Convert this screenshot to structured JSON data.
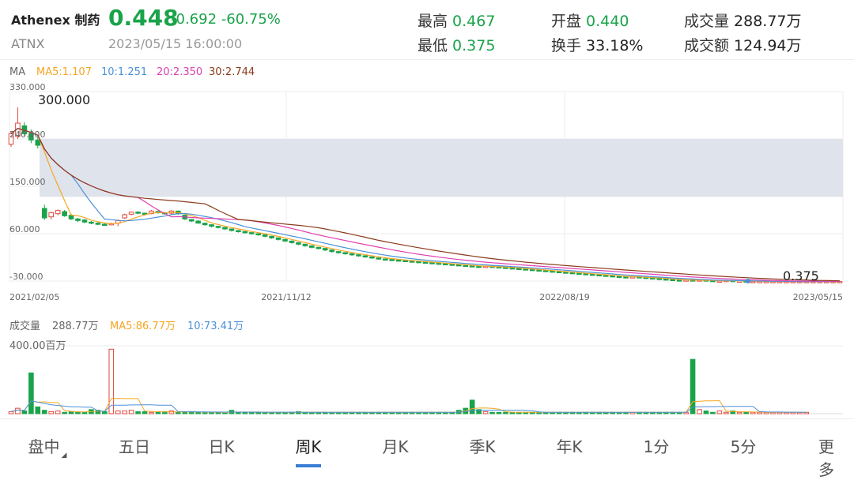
{
  "header": {
    "name": "Athenex 制药",
    "code": "ATNX",
    "price": "0.448",
    "change": "-0.692",
    "change_pct": "-60.75%",
    "datetime": "2023/05/15 16:00:00",
    "stats": [
      {
        "label": "最高",
        "value": "0.467",
        "tone": "green"
      },
      {
        "label": "开盘",
        "value": "0.440",
        "tone": "green"
      },
      {
        "label": "成交量",
        "value": "288.77万",
        "tone": "dark"
      },
      {
        "label": "最低",
        "value": "0.375",
        "tone": "green"
      },
      {
        "label": "换手",
        "value": "33.18%",
        "tone": "dark"
      },
      {
        "label": "成交额",
        "value": "124.94万",
        "tone": "dark"
      }
    ]
  },
  "ma_legend": {
    "title": "MA",
    "ma5": "MA5:1.107",
    "ma10": "10:1.251",
    "ma20": "20:2.350",
    "ma30": "30:2.744"
  },
  "vol_legend": {
    "title": "成交量",
    "value": "288.77万",
    "ma5": "MA5:86.77万",
    "ma10": "10:73.41万"
  },
  "colors": {
    "up": "#e2483d",
    "down": "#1aa34a",
    "ma5": "#f5a623",
    "ma10": "#4a90d9",
    "ma20": "#e040b0",
    "ma30": "#8b3a1a",
    "band": "#dfe4ec"
  },
  "chart_data": {
    "type": "candlestick",
    "y_ticks": [
      "330.000",
      "240.000",
      "150.000",
      "60.000",
      "-30.000"
    ],
    "y_range": [
      -30,
      330
    ],
    "x_labels": [
      "2021/02/05",
      "2021/11/12",
      "2022/08/19",
      "2023/05/15"
    ],
    "annotations": {
      "high_label": "300.000",
      "low_label": "0.375"
    },
    "band": [
      130,
      240
    ],
    "candles": [
      [
        230,
        250,
        225,
        255
      ],
      [
        245,
        270,
        240,
        300
      ],
      [
        265,
        250,
        245,
        272
      ],
      [
        250,
        238,
        232,
        258
      ],
      [
        238,
        228,
        222,
        245
      ],
      [
        108,
        90,
        86,
        115
      ],
      [
        92,
        100,
        87,
        102
      ],
      [
        98,
        104,
        95,
        106
      ],
      [
        102,
        94,
        92,
        105
      ],
      [
        95,
        88,
        86,
        98
      ],
      [
        88,
        85,
        82,
        90
      ],
      [
        86,
        82,
        80,
        88
      ],
      [
        82,
        80,
        78,
        84
      ],
      [
        80,
        78,
        76,
        82
      ],
      [
        78,
        77,
        75,
        80
      ],
      [
        77,
        79,
        76,
        81
      ],
      [
        80,
        85,
        74,
        87
      ],
      [
        90,
        96,
        88,
        98
      ],
      [
        97,
        101,
        95,
        102
      ],
      [
        101,
        99,
        97,
        103
      ],
      [
        99,
        97,
        96,
        100
      ],
      [
        98,
        103,
        97,
        105
      ],
      [
        102,
        100,
        98,
        104
      ],
      [
        100,
        98,
        96,
        101
      ],
      [
        99,
        103,
        97,
        105
      ],
      [
        103,
        98,
        96,
        104
      ],
      [
        95,
        88,
        86,
        96
      ],
      [
        87,
        84,
        82,
        88
      ],
      [
        84,
        80,
        79,
        86
      ],
      [
        80,
        77,
        75,
        81
      ],
      [
        77,
        74,
        72,
        78
      ],
      [
        74,
        72,
        70,
        75
      ],
      [
        72,
        69,
        67,
        73
      ],
      [
        69,
        66,
        64,
        70
      ],
      [
        66,
        64,
        62,
        67
      ],
      [
        64,
        62,
        60,
        65
      ],
      [
        62,
        60,
        58,
        63
      ],
      [
        60,
        58,
        56,
        61
      ],
      [
        58,
        55,
        53,
        59
      ],
      [
        55,
        52,
        50,
        56
      ],
      [
        52,
        49,
        47,
        53
      ],
      [
        49,
        46,
        44,
        50
      ],
      [
        46,
        43,
        41,
        47
      ],
      [
        43,
        40,
        38,
        44
      ],
      [
        40,
        37,
        35,
        41
      ],
      [
        37,
        34,
        32,
        38
      ],
      [
        34,
        32,
        30,
        35
      ],
      [
        32,
        29,
        27,
        33
      ],
      [
        29,
        26,
        24,
        30
      ],
      [
        26,
        24,
        22,
        27
      ],
      [
        24,
        22,
        20,
        25
      ],
      [
        22,
        20,
        18,
        23
      ],
      [
        20,
        18,
        16,
        21
      ],
      [
        18,
        16,
        14,
        19
      ],
      [
        16,
        14,
        12,
        17
      ],
      [
        14,
        12,
        10,
        15
      ],
      [
        12,
        11,
        9,
        13
      ],
      [
        11,
        10,
        8,
        12
      ],
      [
        10,
        9,
        7,
        11
      ],
      [
        9,
        8,
        6,
        10
      ],
      [
        8,
        7,
        5,
        9
      ],
      [
        7,
        6,
        4,
        8
      ],
      [
        6,
        5,
        3,
        7
      ],
      [
        5,
        4,
        2,
        6
      ],
      [
        4,
        3,
        1,
        5
      ],
      [
        3,
        2,
        0,
        4
      ],
      [
        2,
        1,
        -1,
        3
      ],
      [
        1,
        0,
        -1,
        2
      ],
      [
        0,
        -1,
        -2,
        1
      ],
      [
        -1,
        -2,
        -3,
        0
      ],
      [
        -2,
        -3,
        -4,
        -1
      ],
      [
        -3,
        -2,
        -4,
        -1
      ],
      [
        -2,
        -3,
        -4,
        -1
      ],
      [
        -3,
        -4,
        -5,
        -2
      ],
      [
        -4,
        -5,
        -6,
        -3
      ],
      [
        -5,
        -6,
        -7,
        -4
      ],
      [
        -6,
        -7,
        -8,
        -5
      ],
      [
        -7,
        -8,
        -9,
        -6
      ],
      [
        -8,
        -9,
        -10,
        -7
      ],
      [
        -9,
        -10,
        -11,
        -8
      ],
      [
        -10,
        -11,
        -12,
        -9
      ],
      [
        -11,
        -12,
        -13,
        -10
      ],
      [
        -12,
        -13,
        -14,
        -11
      ],
      [
        -13,
        -14,
        -15,
        -12
      ],
      [
        -14,
        -15,
        -16,
        -13
      ],
      [
        -15,
        -16,
        -17,
        -14
      ],
      [
        -16,
        -17,
        -18,
        -15
      ],
      [
        -17,
        -18,
        -19,
        -16
      ],
      [
        -18,
        -19,
        -20,
        -17
      ],
      [
        -19,
        -20,
        -21,
        -18
      ],
      [
        -20,
        -21,
        -22,
        -19
      ],
      [
        -21,
        -22,
        -23,
        -20
      ],
      [
        -22,
        -23,
        -24,
        -21
      ],
      [
        -23,
        -22,
        -24,
        -21
      ],
      [
        -22,
        -23,
        -24,
        -21
      ],
      [
        -23,
        -24,
        -25,
        -22
      ],
      [
        -24,
        -25,
        -26,
        -23
      ],
      [
        -25,
        -26,
        -27,
        -24
      ],
      [
        -26,
        -27,
        -28,
        -25
      ],
      [
        -27,
        -28,
        -29,
        -26
      ],
      [
        -28,
        -29,
        -30,
        -27
      ],
      [
        -29,
        -28,
        -30,
        -27
      ],
      [
        -28,
        -29,
        -30,
        -27
      ],
      [
        -29,
        -28,
        -30,
        -27
      ],
      [
        -28,
        -29,
        -30,
        -27
      ],
      [
        -29,
        -30,
        -31,
        -28
      ],
      [
        -30,
        -30,
        -31,
        -29
      ],
      [
        -30,
        -29,
        -31,
        -28
      ],
      [
        -29,
        -30,
        -31,
        -28
      ],
      [
        -30,
        -30,
        -31,
        -29
      ],
      [
        -30,
        -31,
        -32,
        -29
      ],
      [
        -31,
        -31,
        -32,
        -30
      ],
      [
        -31,
        -31,
        -32,
        -30
      ],
      [
        -31,
        -31,
        -32,
        -30
      ],
      [
        -31,
        -31,
        -32,
        -30
      ],
      [
        -31,
        -31,
        -32,
        -30
      ],
      [
        -31,
        -31,
        -32,
        -30
      ],
      [
        -31,
        -31,
        -32,
        -30
      ],
      [
        -31,
        -31,
        -32,
        -30
      ],
      [
        -31,
        -31,
        -32,
        -30
      ],
      [
        -31,
        -31,
        -32,
        -30
      ],
      [
        -31,
        -31,
        -32,
        -30
      ],
      [
        -31,
        -31,
        -32,
        -30
      ],
      [
        -31,
        -31,
        -32,
        -30
      ],
      [
        -31,
        -31,
        -32,
        -30
      ]
    ],
    "volumes": [
      3,
      8,
      4,
      60,
      10,
      5,
      3,
      4,
      2,
      3,
      2,
      2,
      6,
      5,
      3,
      95,
      4,
      4,
      5,
      3,
      3,
      2,
      2,
      3,
      4,
      2,
      2,
      3,
      2,
      2,
      2,
      2,
      1,
      5,
      2,
      2,
      2,
      2,
      2,
      2,
      2,
      2,
      2,
      3,
      2,
      2,
      2,
      2,
      2,
      2,
      2,
      2,
      2,
      2,
      2,
      2,
      2,
      2,
      2,
      2,
      2,
      2,
      2,
      2,
      2,
      2,
      2,
      5,
      8,
      20,
      6,
      3,
      2,
      2,
      2,
      2,
      2,
      2,
      2,
      2,
      2,
      2,
      2,
      2,
      2,
      2,
      2,
      2,
      2,
      2,
      2,
      2,
      2,
      2,
      2,
      2,
      2,
      2,
      2,
      2,
      2,
      2,
      80,
      6,
      4,
      2,
      4,
      2,
      4,
      2,
      2,
      2,
      2,
      2,
      2,
      2,
      2,
      2,
      2,
      2
    ],
    "vol_max": 400,
    "vol_y_label": "400.00百万"
  },
  "tabs": [
    "盘中",
    "五日",
    "日K",
    "周K",
    "月K",
    "季K",
    "年K",
    "1分",
    "5分",
    "更多"
  ],
  "active_tab": "周K"
}
